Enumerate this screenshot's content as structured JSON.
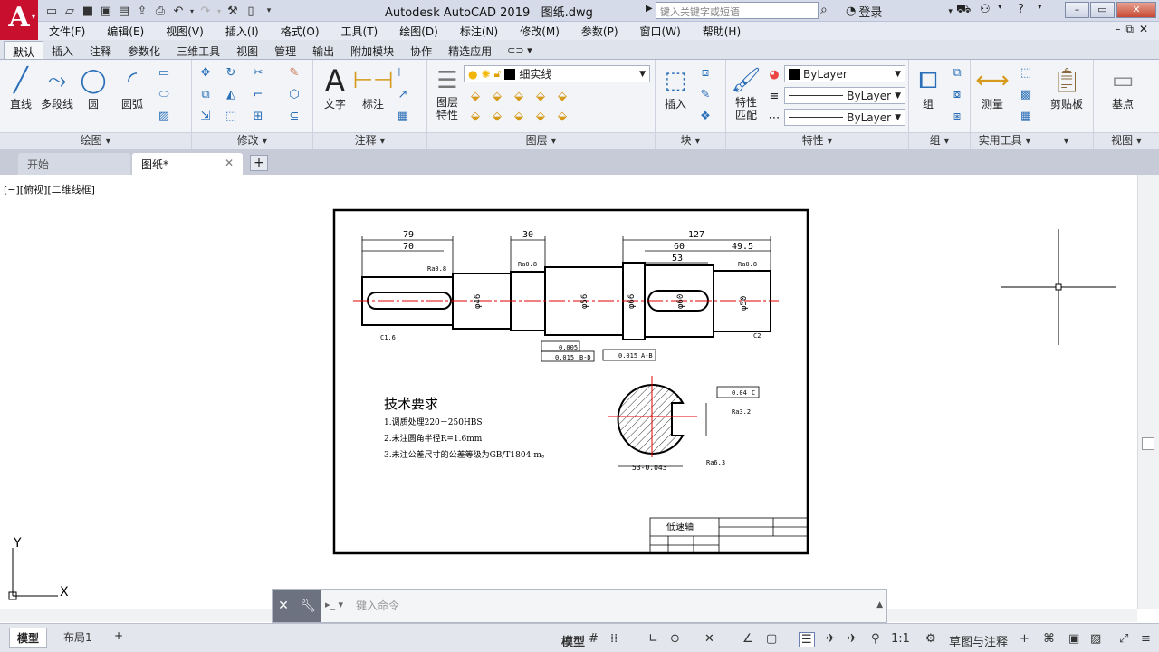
{
  "app": {
    "title": "Autodesk AutoCAD 2019",
    "filename": "图纸.dwg",
    "logo": "A"
  },
  "titlebar": {
    "search_placeholder": "键入关键字或短语",
    "login_label": "登录",
    "help_label": "?"
  },
  "menu": [
    "文件(F)",
    "编辑(E)",
    "视图(V)",
    "插入(I)",
    "格式(O)",
    "工具(T)",
    "绘图(D)",
    "标注(N)",
    "修改(M)",
    "参数(P)",
    "窗口(W)",
    "帮助(H)"
  ],
  "ribbon_tabs": [
    "默认",
    "插入",
    "注释",
    "参数化",
    "三维工具",
    "视图",
    "管理",
    "输出",
    "附加模块",
    "协作",
    "精选应用"
  ],
  "ribbon": {
    "draw": {
      "title": "绘图",
      "line": "直线",
      "polyline": "多段线",
      "circle": "圆",
      "arc": "圆弧"
    },
    "modify": {
      "title": "修改"
    },
    "annotation": {
      "title": "注释",
      "text": "文字",
      "dimension": "标注"
    },
    "layers": {
      "title": "图层",
      "layer_props": "图层\n特性",
      "current_layer": "细实线"
    },
    "block": {
      "title": "块",
      "insert": "插入"
    },
    "properties": {
      "title": "特性",
      "match": "特性\n匹配",
      "color": "ByLayer",
      "linetype": "ByLayer",
      "lineweight": "ByLayer"
    },
    "groups": {
      "title": "组",
      "group": "组"
    },
    "utilities": {
      "title": "实用工具",
      "measure": "测量"
    },
    "clipboard": {
      "title": "剪贴板"
    },
    "view": {
      "title": "视图",
      "base": "基点"
    }
  },
  "file_tabs": {
    "start": "开始",
    "drawing": "图纸*"
  },
  "viewport_label": "[−][俯视][二维线框]",
  "drawing": {
    "dims_top": [
      "79",
      "70",
      "30",
      "127",
      "60",
      "49.5",
      "53"
    ],
    "dia_labels": [
      "φ46",
      "φ56",
      "φ66",
      "φ60",
      "φ50"
    ],
    "tolerances": [
      "0.005",
      "0.015",
      "B-D",
      "0.015",
      "A-B",
      "0.04",
      "C"
    ],
    "roughness": [
      "Ra0.8",
      "Ra0.8",
      "Ra0.8",
      "Ra3.2",
      "Ra6.3"
    ],
    "chamfers": [
      "C1.6",
      "C2"
    ],
    "section_dims": [
      "53-0.043"
    ],
    "tech_req_title": "技术要求",
    "tech_req": [
      "1.调质处理220－250HBS",
      "2.未注圆角半径R=1.6mm",
      "3.未注公差尺寸的公差等级为GB/T1804-m。"
    ],
    "title_block": {
      "name": "低速轴"
    },
    "ucs": {
      "x": "X",
      "y": "Y"
    }
  },
  "cmdline": {
    "placeholder": "键入命令"
  },
  "layout_tabs": {
    "model": "模型",
    "layout1": "布局1"
  },
  "status": {
    "model_label": "模型",
    "scale": "1:1",
    "workspace": "草图与注释"
  },
  "colors": {
    "accent": "#c8102e",
    "center_line": "#e00000"
  }
}
